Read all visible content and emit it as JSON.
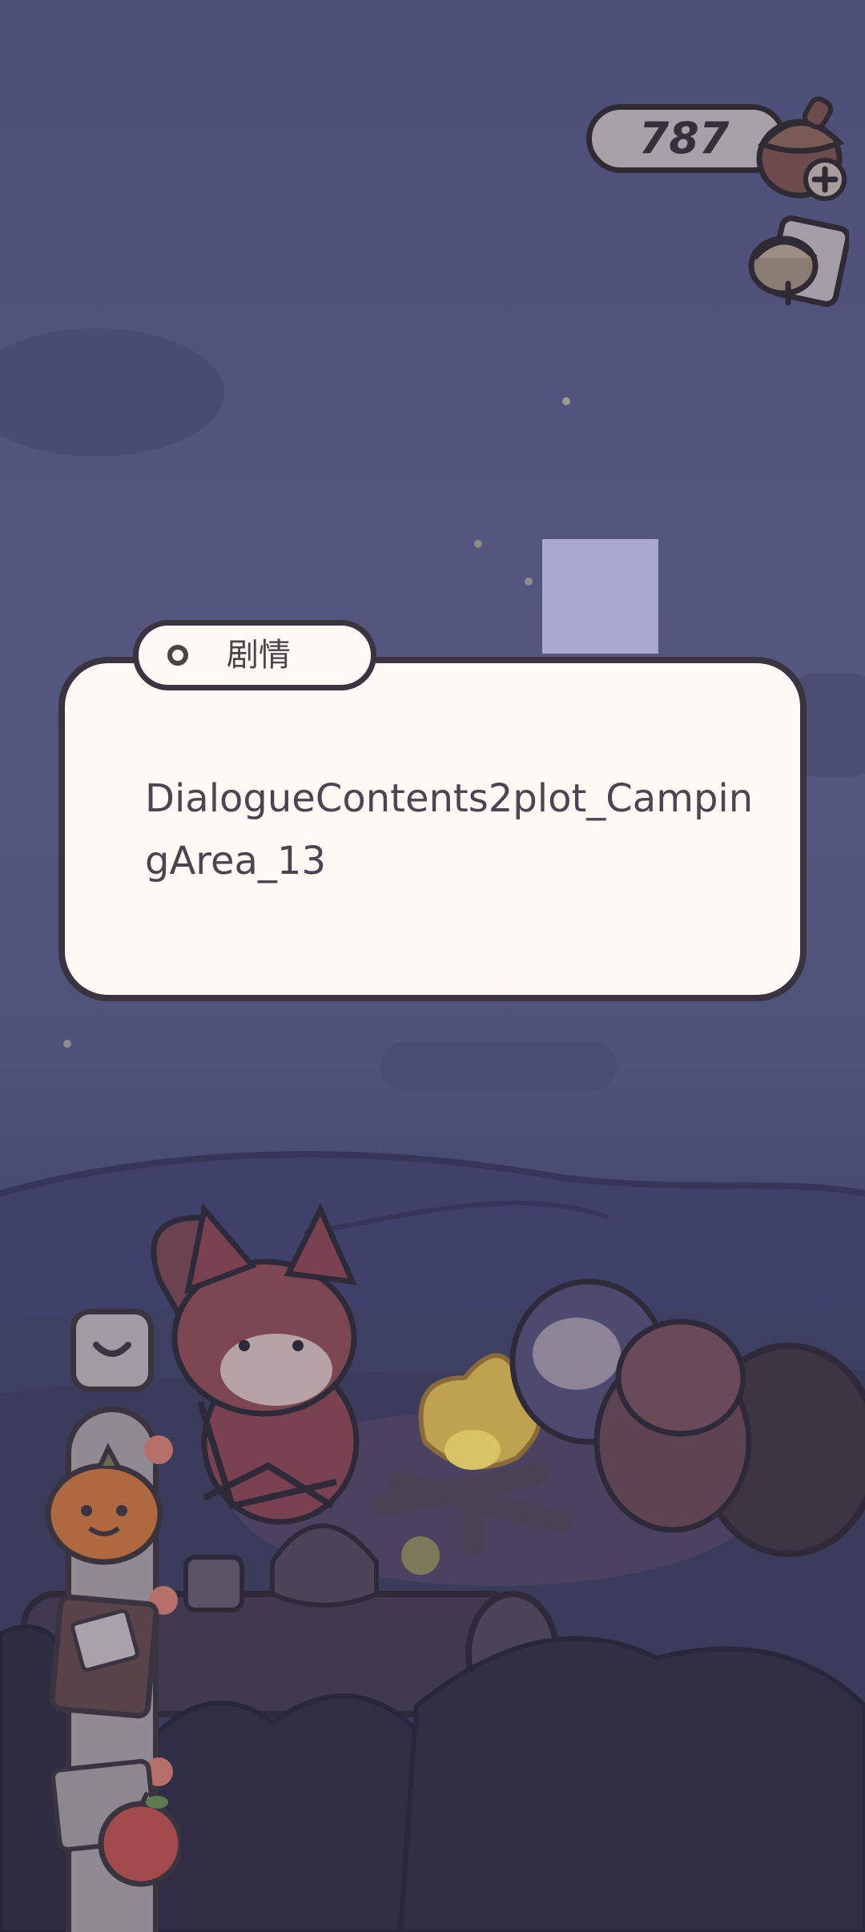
{
  "hud": {
    "acorn_count": "787",
    "currency_icon": "acorn-icon",
    "add_icon": "plus-icon",
    "card_icon": "acorn-card-icon"
  },
  "dialogue": {
    "tab_label": "剧情",
    "text": "DialogueContents2plot_CampingArea_13"
  },
  "side_menu": {
    "collapse_icon": "chevron-down-icon",
    "items": [
      {
        "icon": "pumpkin-icon"
      },
      {
        "icon": "journal-icon"
      },
      {
        "icon": "apple-icon"
      }
    ]
  },
  "colors": {
    "sky": "#545780",
    "dialogue_bg": "#fdf9f4",
    "outline": "#3a3340",
    "pill_bg": "#a7a2a8"
  }
}
